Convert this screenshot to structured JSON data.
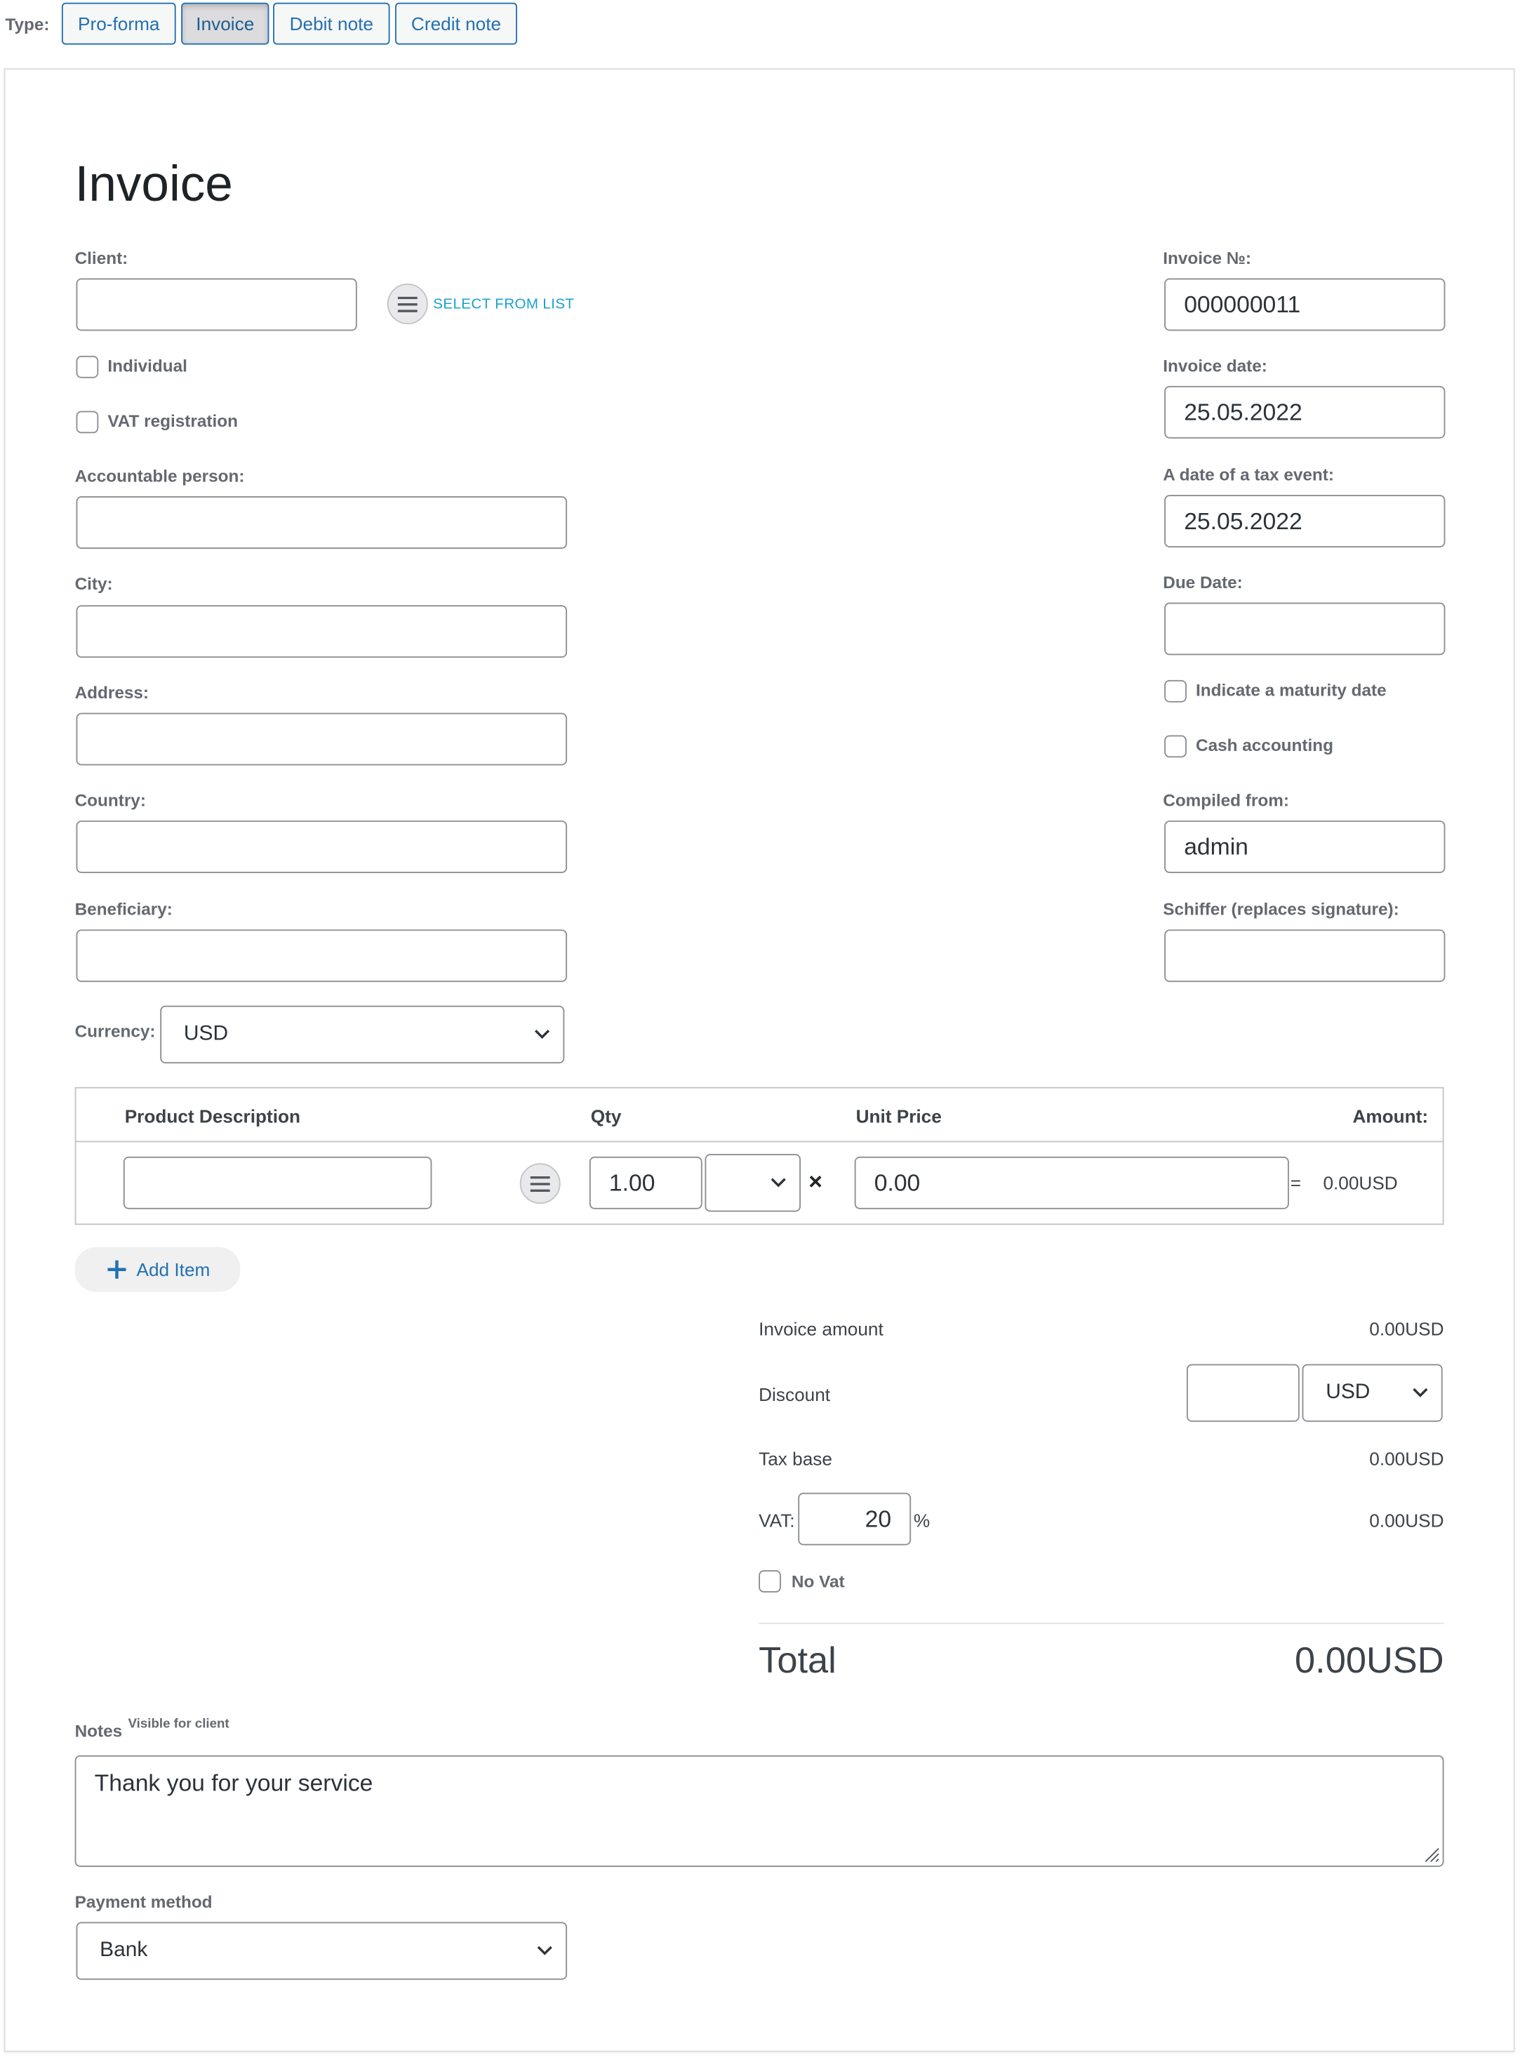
{
  "type_bar": {
    "label": "Type:",
    "buttons": [
      "Pro-forma",
      "Invoice",
      "Debit note",
      "Credit note"
    ],
    "active": "Invoice"
  },
  "form": {
    "title": "Invoice",
    "left": {
      "client_label": "Client:",
      "client_value": "",
      "select_from_list": "SELECT FROM LIST",
      "individual_label": "Individual",
      "vat_registration_label": "VAT registration",
      "accountable_person_label": "Accountable person:",
      "city_label": "City:",
      "address_label": "Address:",
      "country_label": "Country:",
      "beneficiary_label": "Beneficiary:",
      "currency_label": "Currency:",
      "currency_value": "USD"
    },
    "right": {
      "invoice_no_label": "Invoice №:",
      "invoice_no_value": "000000011",
      "invoice_date_label": "Invoice date:",
      "invoice_date_value": "25.05.2022",
      "tax_event_label": "A date of a tax event:",
      "tax_event_value": "25.05.2022",
      "due_date_label": "Due Date:",
      "maturity_label": "Indicate a maturity date",
      "cash_accounting_label": "Cash accounting",
      "compiled_from_label": "Compiled from:",
      "compiled_from_value": "admin",
      "schiffer_label": "Schiffer (replaces signature):"
    },
    "table": {
      "headers": {
        "product": "Product Description",
        "qty": "Qty",
        "unit_price": "Unit Price",
        "amount": "Amount:"
      },
      "row": {
        "qty": "1.00",
        "multiply": "×",
        "unit_price": "0.00",
        "equals": "=",
        "amount": "0.00USD"
      }
    },
    "add_item_label": "Add Item",
    "summary": {
      "invoice_amount_label": "Invoice amount",
      "invoice_amount_value": "0.00USD",
      "discount_label": "Discount",
      "discount_currency": "USD",
      "tax_base_label": "Tax base",
      "tax_base_value": "0.00USD",
      "vat_label": "VAT:",
      "vat_percent": "20",
      "percent_sign": "%",
      "vat_value": "0.00USD",
      "no_vat_label": "No Vat",
      "total_label": "Total",
      "total_value": "0.00USD"
    },
    "notes": {
      "label": "Notes",
      "sublabel": "Visible for client",
      "value": "Thank you for your service"
    },
    "payment": {
      "label": "Payment method",
      "value": "Bank"
    }
  },
  "colors": {
    "accent": "#2271b1",
    "link": "#17a2c9"
  }
}
